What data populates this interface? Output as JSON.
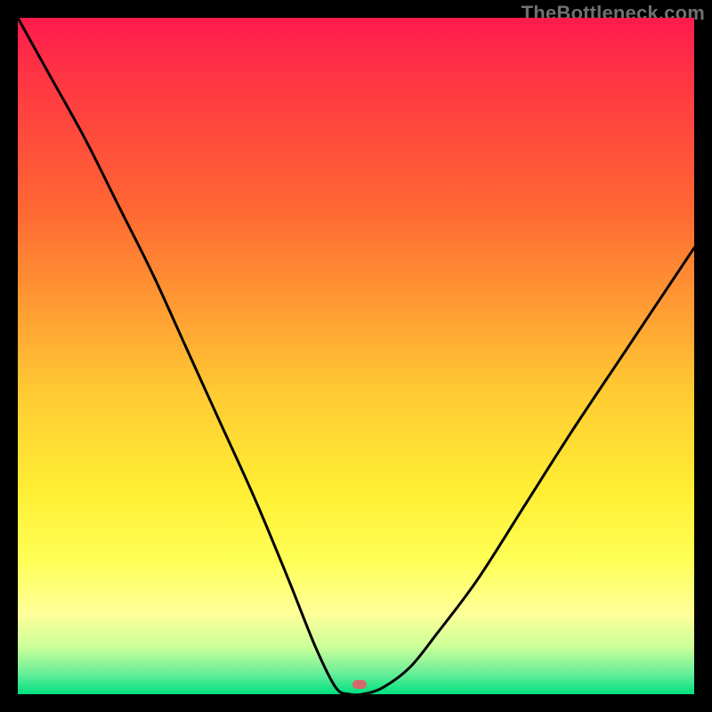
{
  "attribution": "TheBottleneck.com",
  "marker": {
    "x_frac": 0.505,
    "y_frac": 0.985
  },
  "chart_data": {
    "type": "line",
    "title": "",
    "xlabel": "",
    "ylabel": "",
    "xlim": [
      0,
      1
    ],
    "ylim": [
      0,
      1
    ],
    "grid": false,
    "legend": false,
    "gradient_stops": [
      {
        "pos": 0.0,
        "color": "#ff1a4d"
      },
      {
        "pos": 0.08,
        "color": "#ff3344"
      },
      {
        "pos": 0.28,
        "color": "#ff6633"
      },
      {
        "pos": 0.42,
        "color": "#ff9933"
      },
      {
        "pos": 0.56,
        "color": "#ffcc33"
      },
      {
        "pos": 0.7,
        "color": "#ffee33"
      },
      {
        "pos": 0.8,
        "color": "#ffff55"
      },
      {
        "pos": 0.88,
        "color": "#ffff99"
      },
      {
        "pos": 0.93,
        "color": "#ccff99"
      },
      {
        "pos": 0.97,
        "color": "#66ee99"
      },
      {
        "pos": 1.0,
        "color": "#00e080"
      }
    ],
    "series": [
      {
        "name": "bottleneck-curve",
        "x": [
          0.0,
          0.05,
          0.1,
          0.15,
          0.2,
          0.25,
          0.3,
          0.35,
          0.4,
          0.44,
          0.47,
          0.49,
          0.51,
          0.54,
          0.58,
          0.62,
          0.68,
          0.75,
          0.82,
          0.9,
          1.0
        ],
        "y": [
          1.0,
          0.91,
          0.82,
          0.72,
          0.62,
          0.51,
          0.4,
          0.29,
          0.17,
          0.07,
          0.01,
          0.0,
          0.0,
          0.01,
          0.04,
          0.09,
          0.17,
          0.28,
          0.39,
          0.51,
          0.66
        ]
      }
    ],
    "markers": [
      {
        "name": "optimal-point",
        "x": 0.505,
        "y": 0.015,
        "color": "#d56a6a"
      }
    ]
  }
}
